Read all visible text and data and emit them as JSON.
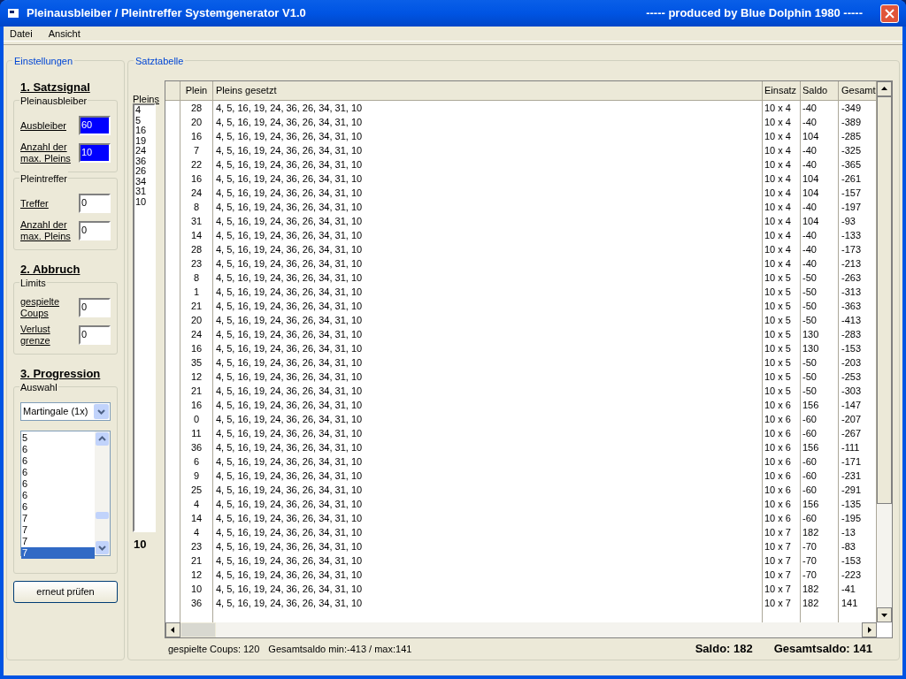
{
  "window": {
    "title": "Pleinausbleiber / Pleintreffer Systemgenerator V1.0",
    "subtitle": "----- produced by Blue Dolphin 1980 -----"
  },
  "menu": [
    "Datei",
    "Ansicht"
  ],
  "settings": {
    "legend": "Einstellungen",
    "blocks": [
      {
        "kind": "heading",
        "text": "1. Satzsignal"
      },
      {
        "kind": "fields",
        "legend": "Pleinausbleiber",
        "fields": [
          {
            "label": "Ausbleiber",
            "value": "60",
            "highlighted": true
          },
          {
            "label": "Anzahl der\nmax. Pleins",
            "value": "10",
            "highlighted": true
          }
        ]
      },
      {
        "kind": "fields",
        "legend": "Pleintreffer",
        "fields": [
          {
            "label": "Treffer",
            "value": "0",
            "highlighted": false
          },
          {
            "label": "Anzahl der\nmax. Pleins",
            "value": "0",
            "highlighted": false
          }
        ]
      },
      {
        "kind": "heading",
        "text": "2. Abbruch"
      },
      {
        "kind": "fields",
        "legend": "Limits",
        "fields": [
          {
            "label": "gespielte\nCoups",
            "value": "0",
            "highlighted": false
          },
          {
            "label": "Verlust\ngrenze",
            "value": "0",
            "highlighted": false
          }
        ]
      },
      {
        "kind": "heading",
        "text": "3. Progression"
      },
      {
        "kind": "progression",
        "legend": "Auswahl",
        "dropdown": "Martingale (1x)",
        "items": [
          {
            "text": "5",
            "selected": false
          },
          {
            "text": "6",
            "selected": false
          },
          {
            "text": "6",
            "selected": false
          },
          {
            "text": "6",
            "selected": false
          },
          {
            "text": "6",
            "selected": false
          },
          {
            "text": "6",
            "selected": false
          },
          {
            "text": "6",
            "selected": false
          },
          {
            "text": "7",
            "selected": false
          },
          {
            "text": "7",
            "selected": false
          },
          {
            "text": "7",
            "selected": false
          },
          {
            "text": "7",
            "selected": true
          }
        ]
      }
    ],
    "button": "erneut prüfen"
  },
  "table_panel": {
    "legend": "Satztabelle",
    "pleins": {
      "label": "Pleins",
      "items": [
        "4",
        "5",
        "16",
        "19",
        "24",
        "36",
        "26",
        "34",
        "31",
        "10"
      ],
      "count": "10"
    },
    "columns": [
      "Plein",
      "Pleins gesetzt",
      "Einsatz",
      "Saldo",
      "Gesamt"
    ],
    "rows": [
      [
        "28",
        "4, 5, 16, 19, 24, 36, 26, 34, 31, 10",
        "10 x 4",
        "-40",
        "-349"
      ],
      [
        "20",
        "4, 5, 16, 19, 24, 36, 26, 34, 31, 10",
        "10 x 4",
        "-40",
        "-389"
      ],
      [
        "16",
        "4, 5, 16, 19, 24, 36, 26, 34, 31, 10",
        "10 x 4",
        "104",
        "-285"
      ],
      [
        "7",
        "4, 5, 16, 19, 24, 36, 26, 34, 31, 10",
        "10 x 4",
        "-40",
        "-325"
      ],
      [
        "22",
        "4, 5, 16, 19, 24, 36, 26, 34, 31, 10",
        "10 x 4",
        "-40",
        "-365"
      ],
      [
        "16",
        "4, 5, 16, 19, 24, 36, 26, 34, 31, 10",
        "10 x 4",
        "104",
        "-261"
      ],
      [
        "24",
        "4, 5, 16, 19, 24, 36, 26, 34, 31, 10",
        "10 x 4",
        "104",
        "-157"
      ],
      [
        "8",
        "4, 5, 16, 19, 24, 36, 26, 34, 31, 10",
        "10 x 4",
        "-40",
        "-197"
      ],
      [
        "31",
        "4, 5, 16, 19, 24, 36, 26, 34, 31, 10",
        "10 x 4",
        "104",
        "-93"
      ],
      [
        "14",
        "4, 5, 16, 19, 24, 36, 26, 34, 31, 10",
        "10 x 4",
        "-40",
        "-133"
      ],
      [
        "28",
        "4, 5, 16, 19, 24, 36, 26, 34, 31, 10",
        "10 x 4",
        "-40",
        "-173"
      ],
      [
        "23",
        "4, 5, 16, 19, 24, 36, 26, 34, 31, 10",
        "10 x 4",
        "-40",
        "-213"
      ],
      [
        "8",
        "4, 5, 16, 19, 24, 36, 26, 34, 31, 10",
        "10 x 5",
        "-50",
        "-263"
      ],
      [
        "1",
        "4, 5, 16, 19, 24, 36, 26, 34, 31, 10",
        "10 x 5",
        "-50",
        "-313"
      ],
      [
        "21",
        "4, 5, 16, 19, 24, 36, 26, 34, 31, 10",
        "10 x 5",
        "-50",
        "-363"
      ],
      [
        "20",
        "4, 5, 16, 19, 24, 36, 26, 34, 31, 10",
        "10 x 5",
        "-50",
        "-413"
      ],
      [
        "24",
        "4, 5, 16, 19, 24, 36, 26, 34, 31, 10",
        "10 x 5",
        "130",
        "-283"
      ],
      [
        "16",
        "4, 5, 16, 19, 24, 36, 26, 34, 31, 10",
        "10 x 5",
        "130",
        "-153"
      ],
      [
        "35",
        "4, 5, 16, 19, 24, 36, 26, 34, 31, 10",
        "10 x 5",
        "-50",
        "-203"
      ],
      [
        "12",
        "4, 5, 16, 19, 24, 36, 26, 34, 31, 10",
        "10 x 5",
        "-50",
        "-253"
      ],
      [
        "21",
        "4, 5, 16, 19, 24, 36, 26, 34, 31, 10",
        "10 x 5",
        "-50",
        "-303"
      ],
      [
        "16",
        "4, 5, 16, 19, 24, 36, 26, 34, 31, 10",
        "10 x 6",
        "156",
        "-147"
      ],
      [
        "0",
        "4, 5, 16, 19, 24, 36, 26, 34, 31, 10",
        "10 x 6",
        "-60",
        "-207"
      ],
      [
        "11",
        "4, 5, 16, 19, 24, 36, 26, 34, 31, 10",
        "10 x 6",
        "-60",
        "-267"
      ],
      [
        "36",
        "4, 5, 16, 19, 24, 36, 26, 34, 31, 10",
        "10 x 6",
        "156",
        "-111"
      ],
      [
        "6",
        "4, 5, 16, 19, 24, 36, 26, 34, 31, 10",
        "10 x 6",
        "-60",
        "-171"
      ],
      [
        "9",
        "4, 5, 16, 19, 24, 36, 26, 34, 31, 10",
        "10 x 6",
        "-60",
        "-231"
      ],
      [
        "25",
        "4, 5, 16, 19, 24, 36, 26, 34, 31, 10",
        "10 x 6",
        "-60",
        "-291"
      ],
      [
        "4",
        "4, 5, 16, 19, 24, 36, 26, 34, 31, 10",
        "10 x 6",
        "156",
        "-135"
      ],
      [
        "14",
        "4, 5, 16, 19, 24, 36, 26, 34, 31, 10",
        "10 x 6",
        "-60",
        "-195"
      ],
      [
        "4",
        "4, 5, 16, 19, 24, 36, 26, 34, 31, 10",
        "10 x 7",
        "182",
        "-13"
      ],
      [
        "23",
        "4, 5, 16, 19, 24, 36, 26, 34, 31, 10",
        "10 x 7",
        "-70",
        "-83"
      ],
      [
        "21",
        "4, 5, 16, 19, 24, 36, 26, 34, 31, 10",
        "10 x 7",
        "-70",
        "-153"
      ],
      [
        "12",
        "4, 5, 16, 19, 24, 36, 26, 34, 31, 10",
        "10 x 7",
        "-70",
        "-223"
      ],
      [
        "10",
        "4, 5, 16, 19, 24, 36, 26, 34, 31, 10",
        "10 x 7",
        "182",
        "-41"
      ],
      [
        "36",
        "4, 5, 16, 19, 24, 36, 26, 34, 31, 10",
        "10 x 7",
        "182",
        "141"
      ]
    ],
    "status": {
      "coups": "gespielte Coups: 120",
      "range": "Gesamtsaldo min:-413 / max:141",
      "saldo": "Saldo: 182",
      "gesamtsaldo": "Gesamtsaldo: 141"
    }
  }
}
